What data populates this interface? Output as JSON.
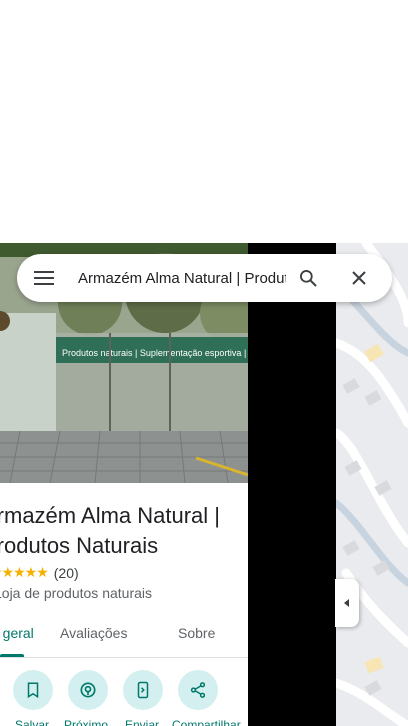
{
  "search": {
    "query": "Armazém Alma Natural | Produtos Naturais",
    "menu_icon": "menu-icon",
    "search_icon": "search-icon",
    "close_icon": "close-icon"
  },
  "place": {
    "photo_signage": "Produtos naturais | Suplementação esportiva | Fitoterá",
    "title": "Armazém Alma Natural | Produtos Naturais",
    "rating_stars": "★★★★★",
    "review_count": "(20)",
    "category": "Loja de produtos naturais"
  },
  "tabs": [
    {
      "label": "Visão geral",
      "active": true
    },
    {
      "label": "Avaliações",
      "active": false
    },
    {
      "label": "Sobre",
      "active": false
    }
  ],
  "actions": [
    {
      "label": "Salvar",
      "icon": "bookmark-icon"
    },
    {
      "label": "Próximo",
      "icon": "nearby-icon"
    },
    {
      "label": "Enviar",
      "icon": "send-to-phone-icon"
    },
    {
      "label": "Compartilhar",
      "icon": "share-icon"
    }
  ],
  "colors": {
    "accent": "#00796b",
    "action_bg": "#d4efef",
    "star": "#f5b100"
  }
}
